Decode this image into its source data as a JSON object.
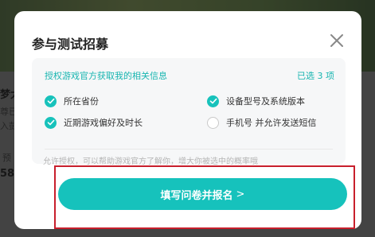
{
  "background": {
    "title_fragment": "梦大",
    "line2": "尊已",
    "line3": "入彭",
    "side_label": "预",
    "side_number": "58"
  },
  "modal": {
    "title": "参与测试招募",
    "close_icon": "close-icon",
    "info": {
      "header": "授权游戏官方获取我的相关信息",
      "selected_count": "已选 3 项",
      "items": [
        {
          "label": "所在省份",
          "checked": true
        },
        {
          "label": "设备型号及系统版本",
          "checked": true
        },
        {
          "label": "近期游戏偏好及时长",
          "checked": true
        },
        {
          "label": "手机号 并允许发送短信",
          "checked": false
        }
      ]
    },
    "note": "允许授权，可以帮助游戏官方了解你，增大你被选中的概率哦",
    "submit_label": "填写问卷并报名",
    "submit_chevron": ">"
  },
  "colors": {
    "accent": "#16c2bc",
    "highlight_frame": "#c81f2c"
  }
}
